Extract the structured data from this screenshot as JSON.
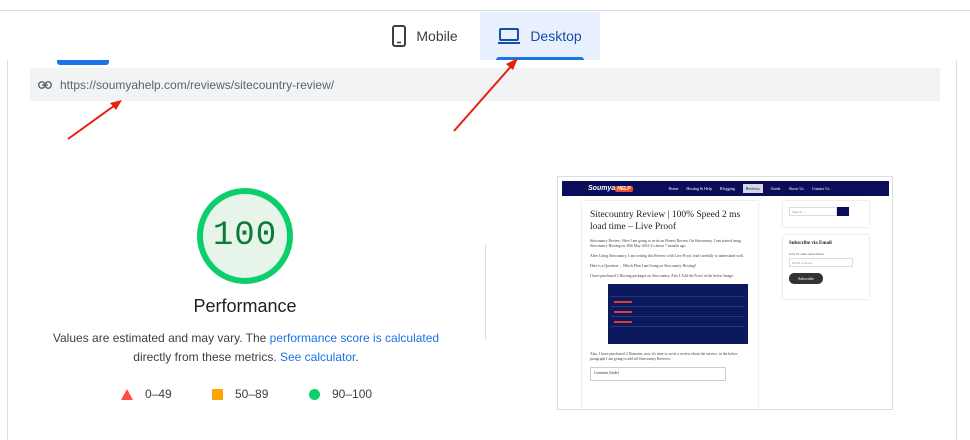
{
  "tabs": [
    {
      "label": "Mobile",
      "icon": "phone-icon"
    },
    {
      "label": "Desktop",
      "icon": "laptop-icon",
      "active": true
    }
  ],
  "url": "https://soumyahelp.com/reviews/sitecountry-review/",
  "score": {
    "value": "100",
    "title": "Performance",
    "color": "#0cce6b"
  },
  "note": {
    "prefix": "Values are estimated and may vary. The ",
    "link1": "performance score is calculated",
    "middle": " directly from these metrics. ",
    "link2": "See calculator",
    "suffix": "."
  },
  "legend": [
    {
      "range": "0–49",
      "shape": "triangle",
      "color": "#ff4e42"
    },
    {
      "range": "50–89",
      "shape": "square",
      "color": "#ffa400"
    },
    {
      "range": "90–100",
      "shape": "circle",
      "color": "#0cce6b"
    }
  ],
  "preview": {
    "logo": "Soumya",
    "logo_badge": "HELP",
    "nav": [
      "Home",
      "Hosting & Help",
      "Blogging",
      "Reviews",
      "Guide",
      "About Us",
      "Contact Us"
    ],
    "title": "Sitecountry Review | 100% Speed 2 ms load time – Live Proof",
    "para1": "Sitecountry Review: Here I am going to write an Honest Review On Sitecountry. I am started using Sitecountry Hosting on 30th May 2021 it's about 7 months ago.",
    "para2": "After Using Sitecountry, I am writing this Review with Live Proof, read carefully to understand well.",
    "para3": "Here is a Question… Which Plan I am Using on Sitecountry Hosting?",
    "para4": "I have purchased 3 Hosting packages on Sitecountry, Also I Add the Proof in the below Image.",
    "para5": "Also, I have purchased 4 Domains, now it's time to write a review about the service, in the below paragraph I am going to add all Sitecountry Reviews.",
    "toc": "Contents [hide]",
    "search_placeholder": "Search ...",
    "subscribe_title": "Subscribe via Email",
    "subscribe_small": "Join 23 other subscribers",
    "email_placeholder": "Email Address",
    "subscribe_button": "Subscribe"
  }
}
